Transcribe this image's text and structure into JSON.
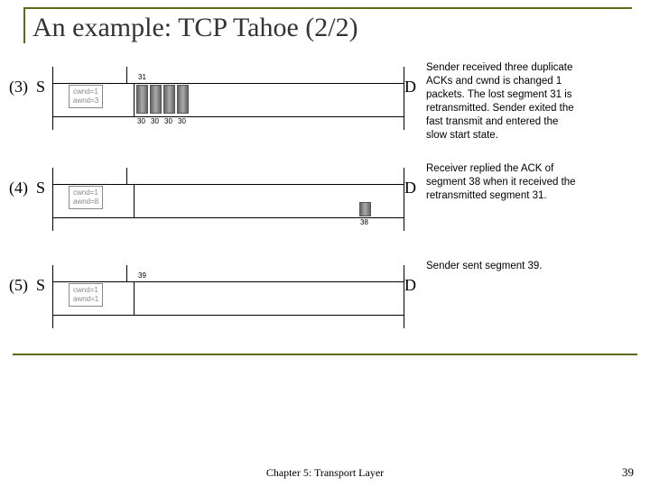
{
  "title": "An example: TCP Tahoe (2/2)",
  "footer": {
    "chapter": "Chapter 5: Transport Layer",
    "page": "39"
  },
  "rows": [
    {
      "step": "(3)",
      "s": "S",
      "d": "D",
      "cwnd": "cwnd=1\nawnd=3",
      "desc": "Sender received three duplicate ACKs and cwnd is changed 1 packets. The lost segment 31 is retransmitted. Sender exited the fast transmit and entered the slow start state.",
      "top_seg": "31",
      "bot_segs": [
        "30",
        "30",
        "30",
        "30"
      ]
    },
    {
      "step": "(4)",
      "s": "S",
      "d": "D",
      "cwnd": "cwnd=1\nawnd=8",
      "desc": "Receiver replied the ACK of segment 38 when it received the retransmitted segment 31.",
      "recv_seg": "38"
    },
    {
      "step": "(5)",
      "s": "S",
      "d": "D",
      "cwnd": "cwnd=1\nawnd=1",
      "desc": "Sender sent segment 39.",
      "top_seg": "39"
    }
  ]
}
